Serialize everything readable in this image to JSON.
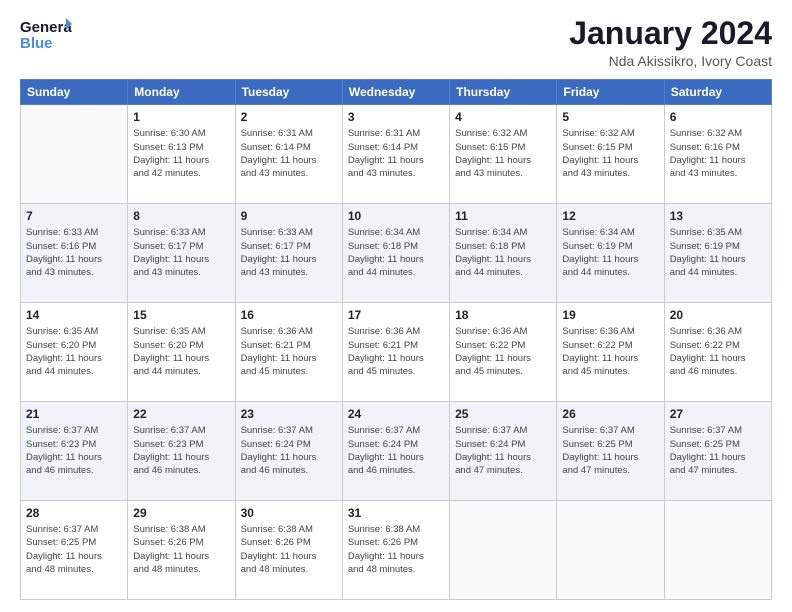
{
  "header": {
    "logo_line1": "General",
    "logo_line2": "Blue",
    "title": "January 2024",
    "subtitle": "Nda Akissikro, Ivory Coast"
  },
  "calendar": {
    "days_of_week": [
      "Sunday",
      "Monday",
      "Tuesday",
      "Wednesday",
      "Thursday",
      "Friday",
      "Saturday"
    ],
    "weeks": [
      [
        {
          "day": "",
          "info": ""
        },
        {
          "day": "1",
          "info": "Sunrise: 6:30 AM\nSunset: 6:13 PM\nDaylight: 11 hours\nand 42 minutes."
        },
        {
          "day": "2",
          "info": "Sunrise: 6:31 AM\nSunset: 6:14 PM\nDaylight: 11 hours\nand 43 minutes."
        },
        {
          "day": "3",
          "info": "Sunrise: 6:31 AM\nSunset: 6:14 PM\nDaylight: 11 hours\nand 43 minutes."
        },
        {
          "day": "4",
          "info": "Sunrise: 6:32 AM\nSunset: 6:15 PM\nDaylight: 11 hours\nand 43 minutes."
        },
        {
          "day": "5",
          "info": "Sunrise: 6:32 AM\nSunset: 6:15 PM\nDaylight: 11 hours\nand 43 minutes."
        },
        {
          "day": "6",
          "info": "Sunrise: 6:32 AM\nSunset: 6:16 PM\nDaylight: 11 hours\nand 43 minutes."
        }
      ],
      [
        {
          "day": "7",
          "info": "Sunrise: 6:33 AM\nSunset: 6:16 PM\nDaylight: 11 hours\nand 43 minutes."
        },
        {
          "day": "8",
          "info": "Sunrise: 6:33 AM\nSunset: 6:17 PM\nDaylight: 11 hours\nand 43 minutes."
        },
        {
          "day": "9",
          "info": "Sunrise: 6:33 AM\nSunset: 6:17 PM\nDaylight: 11 hours\nand 43 minutes."
        },
        {
          "day": "10",
          "info": "Sunrise: 6:34 AM\nSunset: 6:18 PM\nDaylight: 11 hours\nand 44 minutes."
        },
        {
          "day": "11",
          "info": "Sunrise: 6:34 AM\nSunset: 6:18 PM\nDaylight: 11 hours\nand 44 minutes."
        },
        {
          "day": "12",
          "info": "Sunrise: 6:34 AM\nSunset: 6:19 PM\nDaylight: 11 hours\nand 44 minutes."
        },
        {
          "day": "13",
          "info": "Sunrise: 6:35 AM\nSunset: 6:19 PM\nDaylight: 11 hours\nand 44 minutes."
        }
      ],
      [
        {
          "day": "14",
          "info": "Sunrise: 6:35 AM\nSunset: 6:20 PM\nDaylight: 11 hours\nand 44 minutes."
        },
        {
          "day": "15",
          "info": "Sunrise: 6:35 AM\nSunset: 6:20 PM\nDaylight: 11 hours\nand 44 minutes."
        },
        {
          "day": "16",
          "info": "Sunrise: 6:36 AM\nSunset: 6:21 PM\nDaylight: 11 hours\nand 45 minutes."
        },
        {
          "day": "17",
          "info": "Sunrise: 6:36 AM\nSunset: 6:21 PM\nDaylight: 11 hours\nand 45 minutes."
        },
        {
          "day": "18",
          "info": "Sunrise: 6:36 AM\nSunset: 6:22 PM\nDaylight: 11 hours\nand 45 minutes."
        },
        {
          "day": "19",
          "info": "Sunrise: 6:36 AM\nSunset: 6:22 PM\nDaylight: 11 hours\nand 45 minutes."
        },
        {
          "day": "20",
          "info": "Sunrise: 6:36 AM\nSunset: 6:22 PM\nDaylight: 11 hours\nand 46 minutes."
        }
      ],
      [
        {
          "day": "21",
          "info": "Sunrise: 6:37 AM\nSunset: 6:23 PM\nDaylight: 11 hours\nand 46 minutes."
        },
        {
          "day": "22",
          "info": "Sunrise: 6:37 AM\nSunset: 6:23 PM\nDaylight: 11 hours\nand 46 minutes."
        },
        {
          "day": "23",
          "info": "Sunrise: 6:37 AM\nSunset: 6:24 PM\nDaylight: 11 hours\nand 46 minutes."
        },
        {
          "day": "24",
          "info": "Sunrise: 6:37 AM\nSunset: 6:24 PM\nDaylight: 11 hours\nand 46 minutes."
        },
        {
          "day": "25",
          "info": "Sunrise: 6:37 AM\nSunset: 6:24 PM\nDaylight: 11 hours\nand 47 minutes."
        },
        {
          "day": "26",
          "info": "Sunrise: 6:37 AM\nSunset: 6:25 PM\nDaylight: 11 hours\nand 47 minutes."
        },
        {
          "day": "27",
          "info": "Sunrise: 6:37 AM\nSunset: 6:25 PM\nDaylight: 11 hours\nand 47 minutes."
        }
      ],
      [
        {
          "day": "28",
          "info": "Sunrise: 6:37 AM\nSunset: 6:25 PM\nDaylight: 11 hours\nand 48 minutes."
        },
        {
          "day": "29",
          "info": "Sunrise: 6:38 AM\nSunset: 6:26 PM\nDaylight: 11 hours\nand 48 minutes."
        },
        {
          "day": "30",
          "info": "Sunrise: 6:38 AM\nSunset: 6:26 PM\nDaylight: 11 hours\nand 48 minutes."
        },
        {
          "day": "31",
          "info": "Sunrise: 6:38 AM\nSunset: 6:26 PM\nDaylight: 11 hours\nand 48 minutes."
        },
        {
          "day": "",
          "info": ""
        },
        {
          "day": "",
          "info": ""
        },
        {
          "day": "",
          "info": ""
        }
      ]
    ]
  }
}
